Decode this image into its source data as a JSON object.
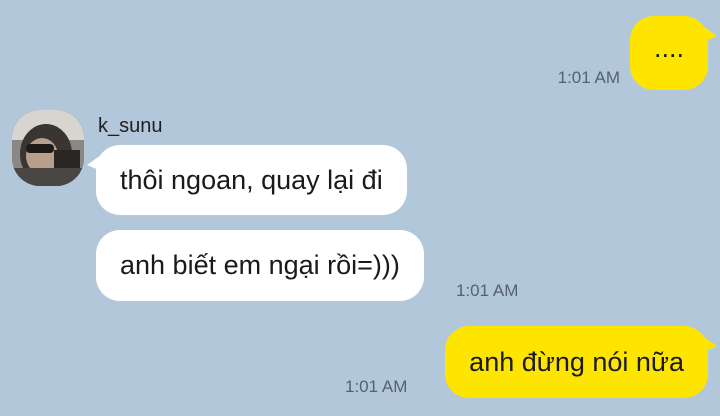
{
  "colors": {
    "background": "#b2c7da",
    "outgoing_bubble": "#fee500",
    "incoming_bubble": "#ffffff",
    "timestamp": "#556270"
  },
  "contact": {
    "name": "k_sunu",
    "avatar_icon": "profile-photo"
  },
  "messages": [
    {
      "direction": "outgoing",
      "text": "....",
      "time": "1:01 AM"
    },
    {
      "direction": "incoming",
      "text": "thôi ngoan, quay lại đi",
      "time": ""
    },
    {
      "direction": "incoming",
      "text": "anh biết em ngại rồi=)))",
      "time": "1:01 AM"
    },
    {
      "direction": "outgoing",
      "text": "anh đừng nói nữa",
      "time": "1:01 AM"
    }
  ]
}
